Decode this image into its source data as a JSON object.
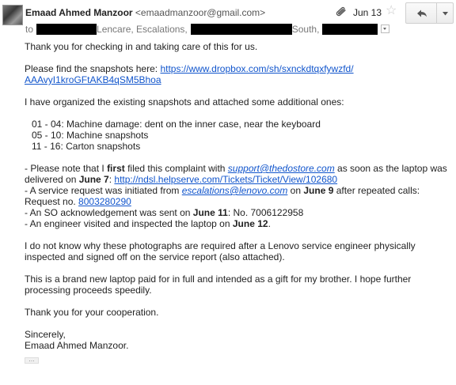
{
  "header": {
    "sender_name": "Emaad Ahmed Manzoor",
    "sender_email": "<emaadmanzoor@gmail.com>",
    "date": "Jun 13",
    "icons": {
      "attachment": "paperclip-icon",
      "star": "star-icon",
      "reply": "reply-icon",
      "more": "chevron-down-icon"
    }
  },
  "recipients": {
    "prefix": "to",
    "part1": "Lencare, Escalations,",
    "part2": "South,"
  },
  "body": {
    "p1": "Thank you for checking in and taking care of this for us.",
    "p2_text": "Please find the snapshots here: ",
    "p2_link_line1": "https://www.dropbox.com/sh/sxnckdtqxfywzfd/",
    "p2_link_line2": "AAAvyI1kroGFtAKB4qSM5Bhoa",
    "p3": "I have organized the existing snapshots and attached some additional ones:",
    "list": [
      "01 - 04: Machine damage: dent on the inner case, near the keyboard",
      "05 - 10: Machine snapshots",
      "11 - 16: Carton snapshots"
    ],
    "b1_a": "- Please note that I ",
    "b1_bold": "first",
    "b1_b": " filed this complaint with ",
    "b1_email": "support@thedostore.com",
    "b1_c": " as soon as the laptop was delivered on ",
    "b1_date": "June 7",
    "b1_d": ": ",
    "b1_link": "http://ndsl.helpserve.com/Tickets/Ticket/View/102680",
    "b2_a": "- A service request was initiated from ",
    "b2_email": "escalations@lenovo.com",
    "b2_b": " on ",
    "b2_date": "June 9",
    "b2_c": " after repeated calls:",
    "b2_req_label": "Request no. ",
    "b2_req_no": "8003280290",
    "b3_a": "- An SO acknowledgement was sent on ",
    "b3_date": "June 11",
    "b3_b": ": No. 7006122958",
    "b4_a": "- An engineer visited and inspected the laptop on ",
    "b4_date": "June 12",
    "b4_b": ".",
    "p5": "I do not know why these photographs are required after a Lenovo service engineer physically inspected and signed off on the service report (also attached).",
    "p6": "This is a brand new laptop paid for in full and intended as a gift for my brother. I hope further processing proceeds speedily.",
    "p7": "Thank you for your cooperation.",
    "sign1": "Sincerely,",
    "sign2": "Emaad Ahmed Manzoor."
  },
  "footer": {
    "ellipsis_label": "…"
  }
}
